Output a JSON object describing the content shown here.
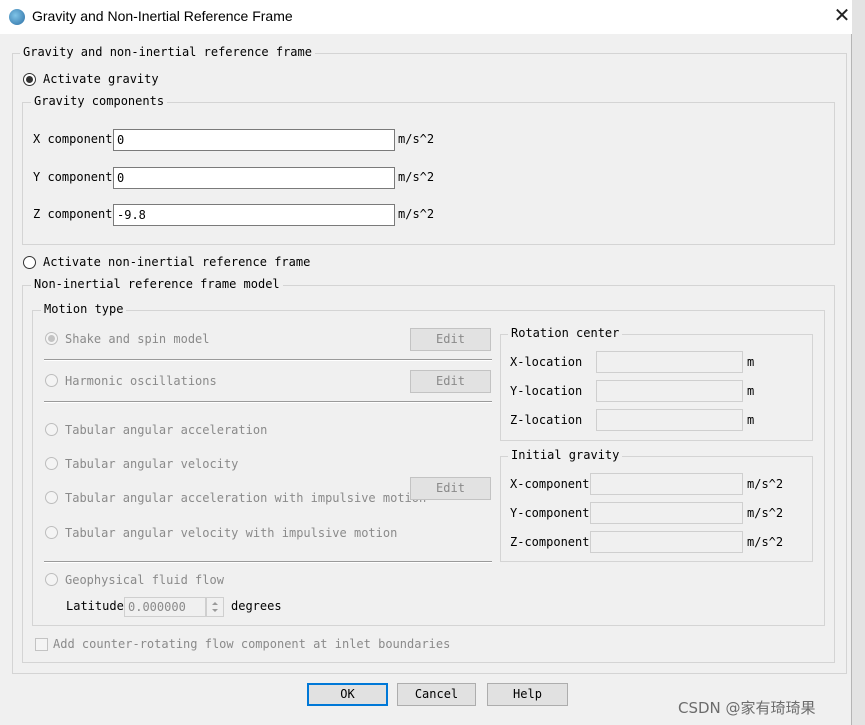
{
  "window": {
    "title": "Gravity and Non-Inertial Reference Frame",
    "close_glyph": "✕"
  },
  "main_group": {
    "legend": "Gravity and non-inertial reference frame"
  },
  "gravity": {
    "activate_label": "Activate gravity",
    "components_legend": "Gravity components",
    "x": {
      "label": "X component",
      "value": "0",
      "unit": "m/s^2"
    },
    "y": {
      "label": "Y component",
      "value": "0",
      "unit": "m/s^2"
    },
    "z": {
      "label": "Z component",
      "value": "-9.8",
      "unit": "m/s^2"
    }
  },
  "noninertial": {
    "activate_label": "Activate non-inertial reference frame",
    "model_legend": "Non-inertial reference frame model",
    "motion_type_legend": "Motion type",
    "options": {
      "shake_spin": "Shake and spin model",
      "harmonic": "Harmonic oscillations",
      "tab_ang_acc": "Tabular angular acceleration",
      "tab_ang_vel": "Tabular angular velocity",
      "tab_ang_acc_imp": "Tabular angular acceleration with impulsive motion",
      "tab_ang_vel_imp": "Tabular angular velocity with impulsive motion",
      "geophysical": "Geophysical fluid flow"
    },
    "edit_label": "Edit",
    "latitude": {
      "label": "Latitude",
      "value": "0.000000",
      "unit": "degrees"
    },
    "rotation_center": {
      "legend": "Rotation center",
      "x_label": "X-location",
      "y_label": "Y-location",
      "z_label": "Z-location",
      "unit": "m"
    },
    "initial_gravity": {
      "legend": "Initial gravity",
      "x_label": "X-component",
      "y_label": "Y-component",
      "z_label": "Z-component",
      "unit": "m/s^2"
    },
    "counter_rotating_label": "Add counter-rotating flow component at inlet boundaries"
  },
  "buttons": {
    "ok": "OK",
    "cancel": "Cancel",
    "help": "Help"
  },
  "watermark": "CSDN @家有琦琦果",
  "colors": {
    "default_button_border": "#0078d7",
    "disabled_text": "#8a8a8a"
  }
}
